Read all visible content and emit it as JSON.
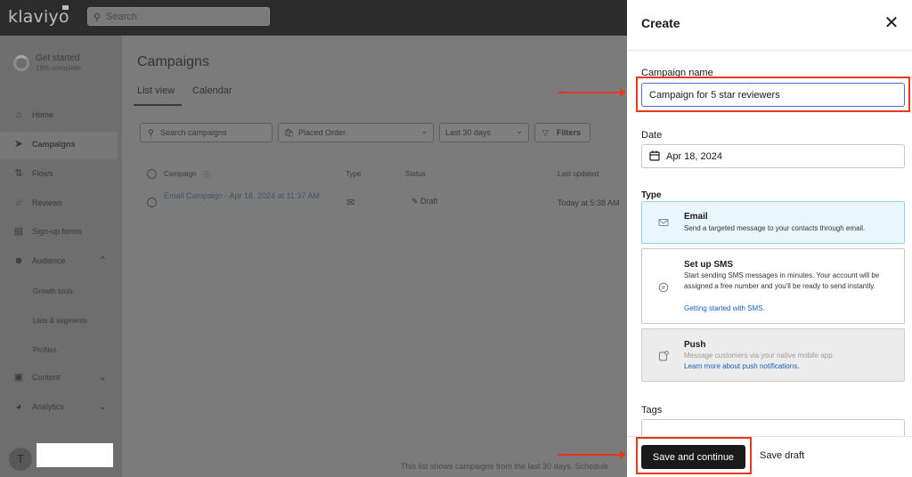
{
  "topbar": {
    "logo": "klaviyo",
    "search_placeholder": "Search"
  },
  "sidebar": {
    "get_started": {
      "title": "Get started",
      "progress_text": "18% complete",
      "progress": 0.18
    },
    "items": [
      {
        "label": "Home",
        "icon": "home-icon"
      },
      {
        "label": "Campaigns",
        "icon": "campaigns-icon",
        "active": true
      },
      {
        "label": "Flows",
        "icon": "flows-icon"
      },
      {
        "label": "Reviews",
        "icon": "star-icon"
      },
      {
        "label": "Sign-up forms",
        "icon": "form-icon"
      },
      {
        "label": "Audience",
        "icon": "audience-icon",
        "expanded": true
      },
      {
        "label": "Content",
        "icon": "content-icon"
      },
      {
        "label": "Analytics",
        "icon": "analytics-icon"
      }
    ],
    "audience_subitems": [
      "Growth tools",
      "Lists & segments",
      "Profiles"
    ],
    "avatar_initial": "T"
  },
  "main": {
    "title": "Campaigns",
    "tabs": [
      "List view",
      "Calendar"
    ],
    "search_placeholder": "Search campaigns",
    "filter_metric": "Placed Order",
    "filter_range": "Last 30 days",
    "filters_label": "Filters",
    "columns": [
      "Campaign",
      "Type",
      "Status",
      "Last updated"
    ],
    "row": {
      "name": "Email Campaign - Apr 18, 2024 at 11:37 AM",
      "status": "Draft",
      "updated": "Today at 5:38 AM"
    },
    "footer_note": "This list shows campaigns from the last 30 days. Schedule"
  },
  "panel": {
    "title": "Create",
    "campaign_name_label": "Campaign name",
    "campaign_name_value": "Campaign for 5 star reviewers",
    "date_label": "Date",
    "date_value": "Apr 18, 2024",
    "type_label": "Type",
    "types": [
      {
        "title": "Email",
        "desc": "Send a targeted message to your contacts through email.",
        "selected": true
      },
      {
        "title": "Set up SMS",
        "desc": "Start sending SMS messages in minutes. Your account will be assigned a free number and you'll be ready to send instantly.",
        "link": "Getting started with SMS."
      },
      {
        "title": "Push",
        "desc": "Message customers via your native mobile app.",
        "link": "Learn more about push notifications.",
        "disabled": true
      }
    ],
    "tags_label": "Tags",
    "save_label": "Save and continue",
    "draft_label": "Save draft"
  },
  "colors": {
    "accent": "#e5391f",
    "selected_card": "#e9f7fc",
    "primary_button": "#1a1a1a",
    "link": "#1a5fb4"
  }
}
